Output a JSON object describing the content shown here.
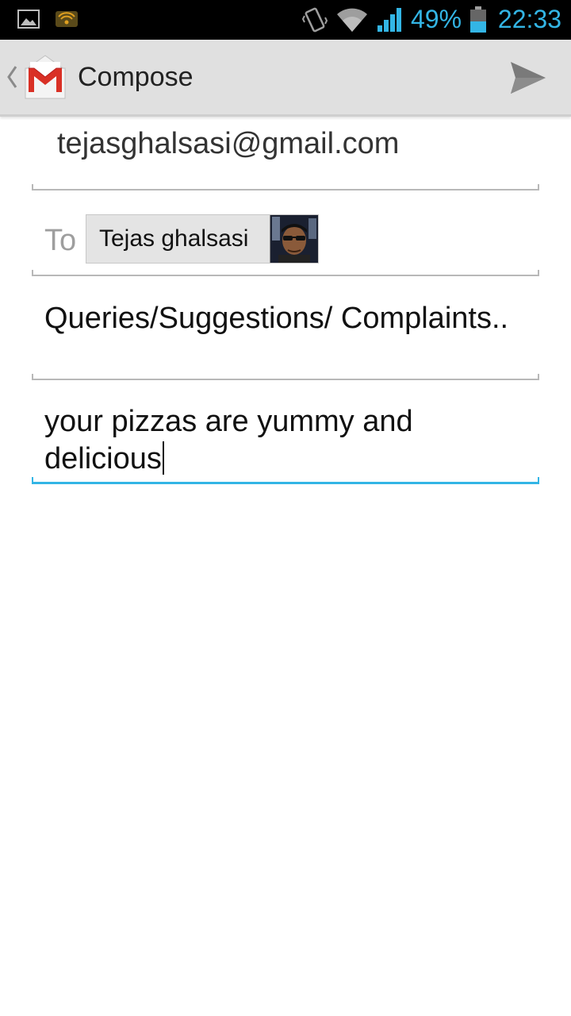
{
  "status_bar": {
    "battery_percent": "49%",
    "time": "22:33",
    "icons": [
      "gallery-icon",
      "rss-icon",
      "vibrate-icon",
      "wifi-icon",
      "signal-icon",
      "battery-icon"
    ],
    "accent_color": "#33b5e5"
  },
  "action_bar": {
    "title": "Compose",
    "icons": [
      "up-caret-icon",
      "gmail-logo-icon",
      "send-icon"
    ]
  },
  "compose": {
    "from": "tejasghalsasi@gmail.com",
    "to_label": "To",
    "recipients": [
      {
        "name": "Tejas ghalsasi",
        "avatar": "contact-photo"
      }
    ],
    "subject": "Queries/Suggestions/ Complaints..",
    "body": "your pizzas are yummy and delicious",
    "focus_color": "#33b5e5"
  }
}
